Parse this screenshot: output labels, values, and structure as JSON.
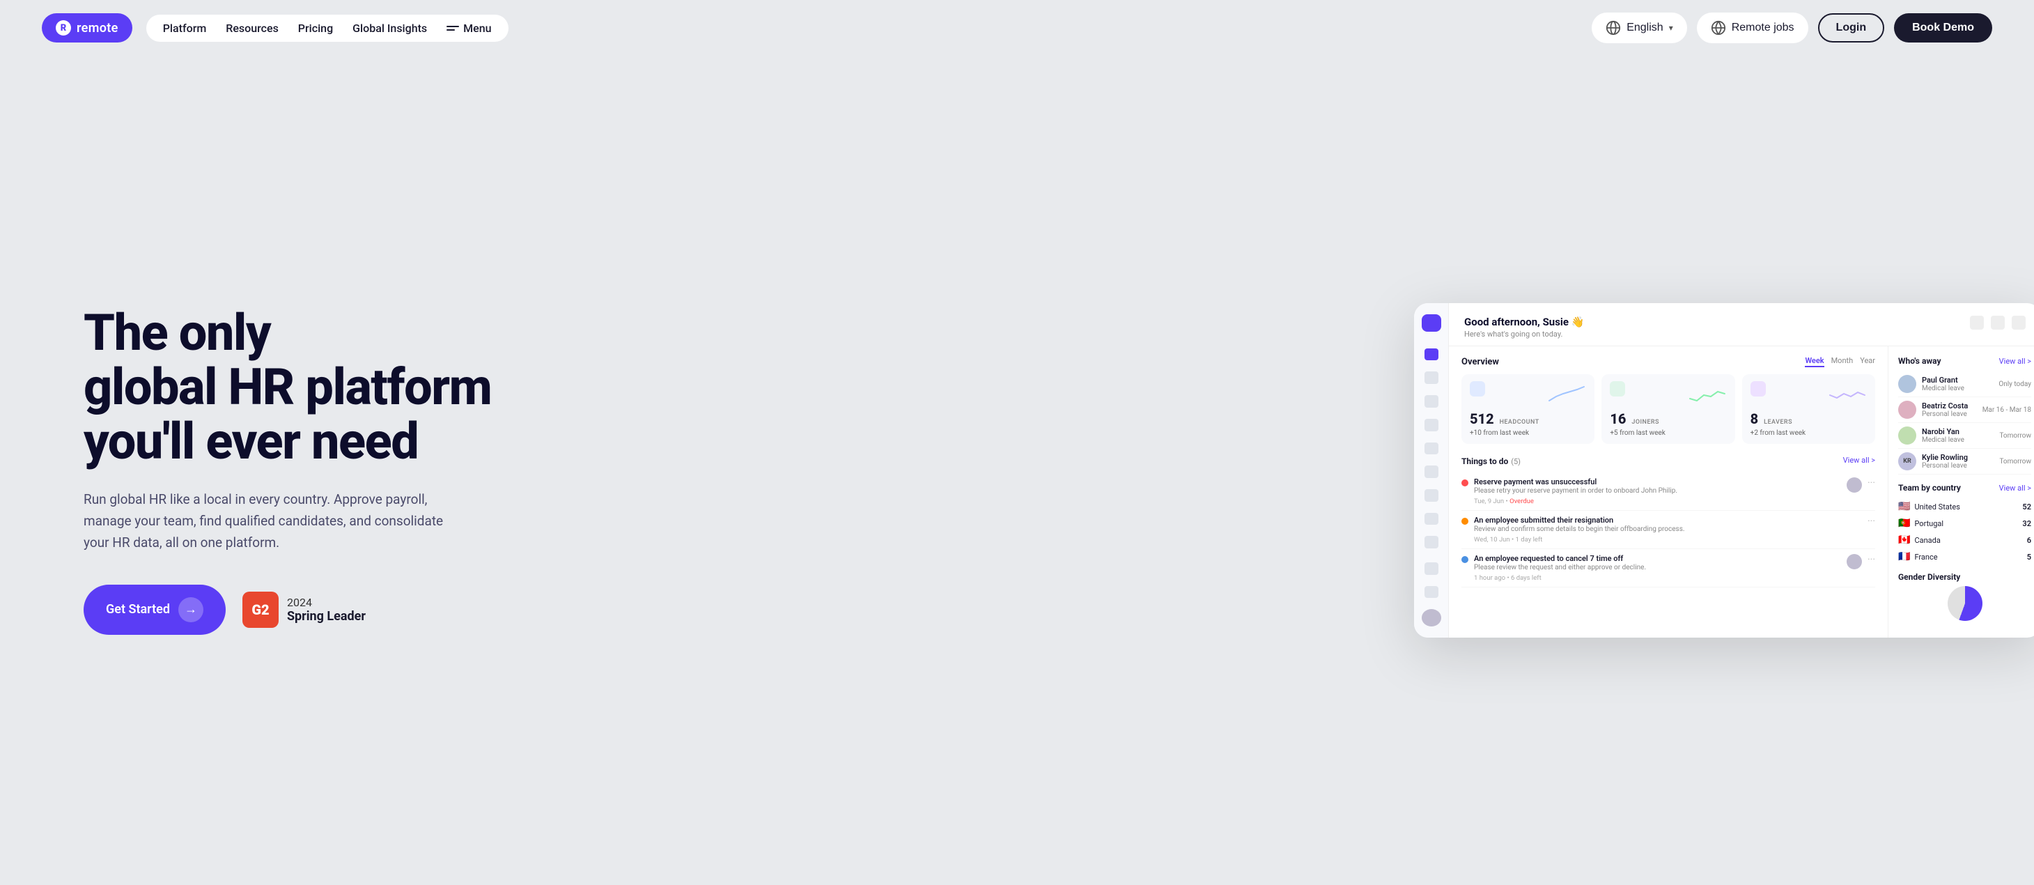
{
  "logo": {
    "icon": "R",
    "text": "remote"
  },
  "nav": {
    "links": [
      {
        "label": "Platform",
        "id": "platform"
      },
      {
        "label": "Resources",
        "id": "resources"
      },
      {
        "label": "Pricing",
        "id": "pricing"
      },
      {
        "label": "Global Insights",
        "id": "global-insights"
      },
      {
        "label": "Menu",
        "id": "menu"
      }
    ]
  },
  "header": {
    "language": "English",
    "remote_jobs": "Remote jobs",
    "login": "Login",
    "book_demo": "Book Demo"
  },
  "hero": {
    "title_line1": "The only",
    "title_line2": "global HR platform",
    "title_line3": "you'll ever need",
    "subtitle": "Run global HR like a local in every country. Approve payroll, manage your team, find qualified candidates, and consolidate your HR data, all on one platform.",
    "cta": "Get Started",
    "g2_year": "2024",
    "g2_label": "Spring Leader"
  },
  "dashboard": {
    "greeting": "Good afternoon, Susie 👋",
    "greeting_sub": "Here's what's going on today.",
    "overview": {
      "title": "Overview",
      "tabs": [
        "Week",
        "Month",
        "Year"
      ],
      "active_tab": "Week",
      "cards": [
        {
          "number": "512",
          "label": "HEADCOUNT",
          "change": "+10 from last week",
          "color": "blue"
        },
        {
          "number": "16",
          "label": "JOINERS",
          "change": "+5 from last week",
          "color": "green"
        },
        {
          "number": "8",
          "label": "LEAVERS",
          "change": "+2 from last week",
          "color": "purple"
        }
      ]
    },
    "todos": {
      "title": "Things to do",
      "count": "5",
      "view_all": "View all >",
      "items": [
        {
          "title": "Reserve payment was unsuccessful",
          "desc": "Please retry your reserve payment in order to onboard John Philip.",
          "date": "Tue, 9 Jun",
          "status": "Overdue",
          "dot": "red"
        },
        {
          "title": "An employee submitted their resignation",
          "desc": "Review and confirm some details to begin their offboarding process.",
          "date": "Wed, 10 Jun",
          "status": "1 day left",
          "dot": "orange"
        },
        {
          "title": "An employee requested to cancel 7 time off",
          "desc": "Please review the request and either approve or decline.",
          "date": "1 hour ago",
          "status": "6 days left",
          "dot": "blue"
        }
      ]
    },
    "whos_away": {
      "title": "Who's away",
      "view_all": "View all >",
      "people": [
        {
          "name": "Paul Grant",
          "leave": "Medical leave",
          "dates": "Only today",
          "avatar_bg": "#b0c4de"
        },
        {
          "name": "Beatriz Costa",
          "leave": "Personal leave",
          "dates": "Mar 16 - Mar 18",
          "avatar_bg": "#deb0c0"
        },
        {
          "name": "Narobi Yan",
          "leave": "Medical leave",
          "dates": "Tomorrow",
          "avatar_bg": "#c0deb0"
        },
        {
          "name": "Kylie Rowling",
          "leave": "Personal leave",
          "dates": "Tomorrow",
          "avatar_bg": "#c0c0de",
          "initials": "KR"
        }
      ]
    },
    "team_by_country": {
      "title": "Team by country",
      "view_all": "View all >",
      "countries": [
        {
          "flag": "🇺🇸",
          "name": "United States",
          "count": "52"
        },
        {
          "flag": "🇵🇹",
          "name": "Portugal",
          "count": "32"
        },
        {
          "flag": "🇨🇦",
          "name": "Canada",
          "count": "6"
        },
        {
          "flag": "🇫🇷",
          "name": "France",
          "count": "5"
        }
      ]
    },
    "gender_diversity": {
      "title": "Gender Diversity"
    }
  }
}
